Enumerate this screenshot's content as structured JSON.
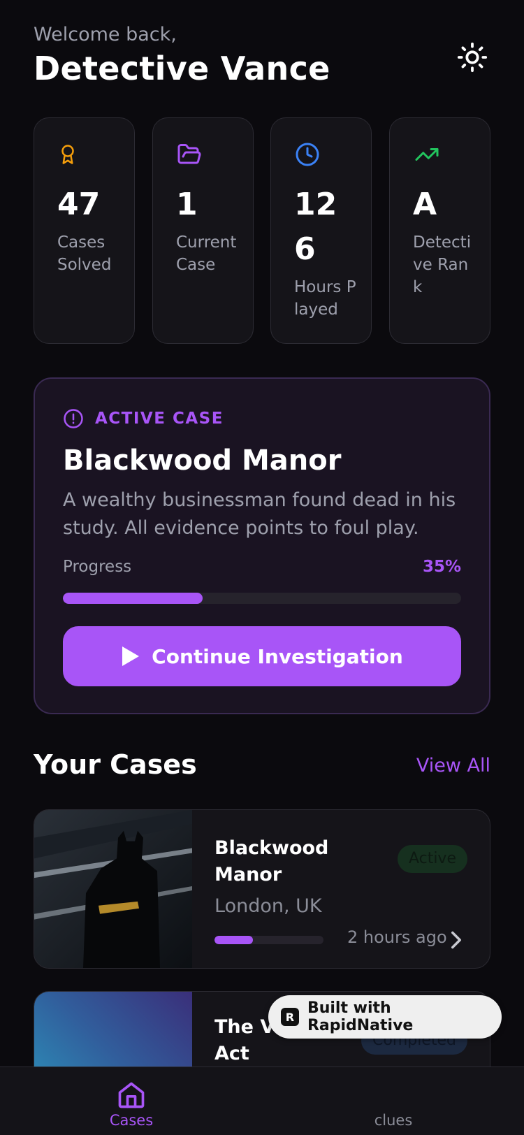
{
  "header": {
    "welcome": "Welcome back,",
    "name": "Detective Vance",
    "theme_icon": "sun-icon"
  },
  "stats": [
    {
      "icon": "award-icon",
      "color": "#f59e0b",
      "value": "47",
      "label": "Cases Solved"
    },
    {
      "icon": "folder-open-icon",
      "color": "#a855f7",
      "value": "1",
      "label": "Current Case"
    },
    {
      "icon": "clock-icon",
      "color": "#3b82f6",
      "value": "126",
      "label": "Hours Played"
    },
    {
      "icon": "trending-up-icon",
      "color": "#22c55e",
      "value": "A",
      "label": "Detective Rank"
    }
  ],
  "active_case": {
    "kicker": "ACTIVE CASE",
    "title": "Blackwood Manor",
    "description": "A wealthy businessman found dead in his study. All evidence points to foul play.",
    "progress_label": "Progress",
    "progress_text": "35%",
    "progress": 0.35,
    "button_label": "Continue Investigation"
  },
  "cases_section": {
    "title": "Your Cases",
    "view_all": "View All"
  },
  "cases": [
    {
      "title": "Blackwood Manor",
      "status": "Active",
      "location": "London, UK",
      "time": "2 hours ago",
      "progress": 0.35
    },
    {
      "title": "The Vanishing Act",
      "status": "Completed"
    }
  ],
  "built_with": "Built with RapidNative",
  "tabs": [
    {
      "label": "Cases",
      "active": true
    },
    {
      "label": "clues",
      "active": false
    }
  ],
  "colors": {
    "accent": "#a855f7",
    "background": "#0b0a0e",
    "card": "#151419"
  }
}
